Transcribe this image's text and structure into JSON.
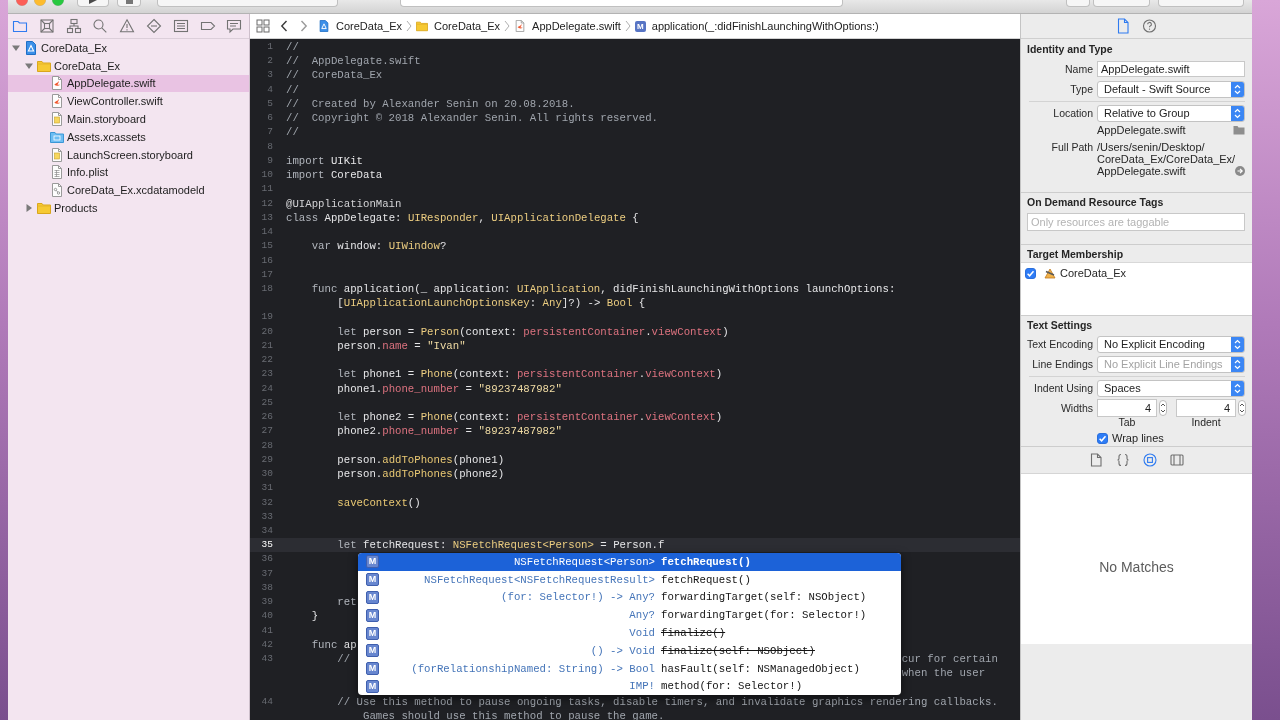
{
  "navigator": {
    "tabs": [
      {
        "selected": true
      },
      {
        "selected": false
      },
      {
        "selected": false
      },
      {
        "selected": false
      },
      {
        "selected": false
      },
      {
        "selected": false
      },
      {
        "selected": false
      },
      {
        "selected": false
      },
      {
        "selected": false
      }
    ],
    "tree": [
      {
        "label": "CoreData_Ex",
        "kind": "project",
        "expanded": true,
        "selected": false,
        "children": [
          {
            "label": "CoreData_Ex",
            "kind": "folder",
            "expanded": true,
            "selected": false,
            "children": [
              {
                "label": "AppDelegate.swift",
                "kind": "swift",
                "selected": true
              },
              {
                "label": "ViewController.swift",
                "kind": "swift",
                "selected": false
              },
              {
                "label": "Main.storyboard",
                "kind": "storyboard",
                "selected": false
              },
              {
                "label": "Assets.xcassets",
                "kind": "assets",
                "selected": false
              },
              {
                "label": "LaunchScreen.storyboard",
                "kind": "storyboard",
                "selected": false
              },
              {
                "label": "Info.plist",
                "kind": "plist",
                "selected": false
              },
              {
                "label": "CoreData_Ex.xcdatamodeld",
                "kind": "datamodel",
                "selected": false
              }
            ]
          },
          {
            "label": "Products",
            "kind": "folder",
            "expanded": false,
            "selected": false
          }
        ]
      }
    ]
  },
  "editor": {
    "jump_bar": {
      "crumbs": [
        {
          "kind": "project",
          "label": "CoreData_Ex"
        },
        {
          "kind": "folder",
          "label": "CoreData_Ex"
        },
        {
          "kind": "swift",
          "label": "AppDelegate.swift"
        },
        {
          "kind": "method",
          "symbol": "M",
          "label": "application(_:didFinishLaunchingWithOptions:)"
        }
      ]
    },
    "lines": [
      {
        "number": "1",
        "current": false,
        "tokens": [
          {
            "kind": "comment",
            "text": "//"
          }
        ]
      },
      {
        "number": "2",
        "current": false,
        "tokens": [
          {
            "kind": "comment",
            "text": "//  AppDelegate.swift"
          }
        ]
      },
      {
        "number": "3",
        "current": false,
        "tokens": [
          {
            "kind": "comment",
            "text": "//  CoreData_Ex"
          }
        ]
      },
      {
        "number": "4",
        "current": false,
        "tokens": [
          {
            "kind": "comment",
            "text": "//"
          }
        ]
      },
      {
        "number": "5",
        "current": false,
        "tokens": [
          {
            "kind": "comment",
            "text": "//  Created by Alexander Senin on 20.08.2018."
          }
        ]
      },
      {
        "number": "6",
        "current": false,
        "tokens": [
          {
            "kind": "comment",
            "text": "//  Copyright © 2018 Alexander Senin. All rights reserved."
          }
        ]
      },
      {
        "number": "7",
        "current": false,
        "tokens": [
          {
            "kind": "comment",
            "text": "//"
          }
        ]
      },
      {
        "number": "8",
        "current": false
      },
      {
        "number": "9",
        "current": false,
        "tokens": [
          {
            "kind": "keyword",
            "text": "import"
          },
          {
            "kind": "plain",
            "text": " UIKit"
          }
        ]
      },
      {
        "number": "10",
        "current": false,
        "tokens": [
          {
            "kind": "keyword",
            "text": "import"
          },
          {
            "kind": "plain",
            "text": " CoreData"
          }
        ]
      },
      {
        "number": "11",
        "current": false
      },
      {
        "number": "12",
        "current": false,
        "tokens": [
          {
            "kind": "attribute",
            "text": "@UIApplicationMain"
          }
        ]
      },
      {
        "number": "13",
        "current": false,
        "tokens": [
          {
            "kind": "keyword",
            "text": "class"
          },
          {
            "kind": "plain",
            "text": " AppDelegate: "
          },
          {
            "kind": "type",
            "text": "UIResponder"
          },
          {
            "kind": "plain",
            "text": ", "
          },
          {
            "kind": "type",
            "text": "UIApplicationDelegate"
          },
          {
            "kind": "plain",
            "text": " {"
          }
        ]
      },
      {
        "number": "14",
        "current": false
      },
      {
        "number": "15",
        "current": false,
        "tokens": [
          {
            "kind": "keyword",
            "text": "    var"
          },
          {
            "kind": "plain",
            "text": " window: "
          },
          {
            "kind": "type",
            "text": "UIWindow"
          },
          {
            "kind": "plain",
            "text": "?"
          }
        ]
      },
      {
        "number": "16",
        "current": false
      },
      {
        "number": "17",
        "current": false
      },
      {
        "number": "18",
        "current": false,
        "rows": [
          {
            "kind": "code",
            "tokens": [
              {
                "kind": "keyword",
                "text": "    func"
              },
              {
                "kind": "plain",
                "text": " application(_ application: "
              },
              {
                "kind": "type",
                "text": "UIApplication"
              },
              {
                "kind": "plain",
                "text": ", didFinishLaunchingWithOptions launchOptions:"
              }
            ]
          },
          {
            "kind": "code",
            "tokens": [
              {
                "kind": "plain",
                "text": "        ["
              },
              {
                "kind": "type",
                "text": "UIApplicationLaunchOptionsKey"
              },
              {
                "kind": "plain",
                "text": ": "
              },
              {
                "kind": "type",
                "text": "Any"
              },
              {
                "kind": "plain",
                "text": "]?) -> "
              },
              {
                "kind": "type",
                "text": "Bool"
              },
              {
                "kind": "plain",
                "text": " {"
              }
            ]
          }
        ]
      },
      {
        "number": "19",
        "current": false
      },
      {
        "number": "20",
        "current": false,
        "tokens": [
          {
            "kind": "keyword",
            "text": "        let"
          },
          {
            "kind": "plain",
            "text": " person = "
          },
          {
            "kind": "type",
            "text": "Person"
          },
          {
            "kind": "plain",
            "text": "(context: "
          },
          {
            "kind": "property",
            "text": "persistentContainer"
          },
          {
            "kind": "plain",
            "text": "."
          },
          {
            "kind": "property",
            "text": "viewContext"
          },
          {
            "kind": "plain",
            "text": ")"
          }
        ]
      },
      {
        "number": "21",
        "current": false,
        "tokens": [
          {
            "kind": "plain",
            "text": "        person."
          },
          {
            "kind": "property",
            "text": "name"
          },
          {
            "kind": "plain",
            "text": " = "
          },
          {
            "kind": "string",
            "text": "\"Ivan\""
          }
        ]
      },
      {
        "number": "22",
        "current": false
      },
      {
        "number": "23",
        "current": false,
        "tokens": [
          {
            "kind": "keyword",
            "text": "        let"
          },
          {
            "kind": "plain",
            "text": " phone1 = "
          },
          {
            "kind": "type",
            "text": "Phone"
          },
          {
            "kind": "plain",
            "text": "(context: "
          },
          {
            "kind": "property",
            "text": "persistentContainer"
          },
          {
            "kind": "plain",
            "text": "."
          },
          {
            "kind": "property",
            "text": "viewContext"
          },
          {
            "kind": "plain",
            "text": ")"
          }
        ]
      },
      {
        "number": "24",
        "current": false,
        "tokens": [
          {
            "kind": "plain",
            "text": "        phone1."
          },
          {
            "kind": "property",
            "text": "phone_number"
          },
          {
            "kind": "plain",
            "text": " = "
          },
          {
            "kind": "string",
            "text": "\"89237487982\""
          }
        ]
      },
      {
        "number": "25",
        "current": false
      },
      {
        "number": "26",
        "current": false,
        "tokens": [
          {
            "kind": "keyword",
            "text": "        let"
          },
          {
            "kind": "plain",
            "text": " phone2 = "
          },
          {
            "kind": "type",
            "text": "Phone"
          },
          {
            "kind": "plain",
            "text": "(context: "
          },
          {
            "kind": "property",
            "text": "persistentContainer"
          },
          {
            "kind": "plain",
            "text": "."
          },
          {
            "kind": "property",
            "text": "viewContext"
          },
          {
            "kind": "plain",
            "text": ")"
          }
        ]
      },
      {
        "number": "27",
        "current": false,
        "tokens": [
          {
            "kind": "plain",
            "text": "        phone2."
          },
          {
            "kind": "property",
            "text": "phone_number"
          },
          {
            "kind": "plain",
            "text": " = "
          },
          {
            "kind": "string",
            "text": "\"89237487982\""
          }
        ]
      },
      {
        "number": "28",
        "current": false
      },
      {
        "number": "29",
        "current": false,
        "tokens": [
          {
            "kind": "plain",
            "text": "        person."
          },
          {
            "kind": "method",
            "text": "addToPhones"
          },
          {
            "kind": "plain",
            "text": "(phone1)"
          }
        ]
      },
      {
        "number": "30",
        "current": false,
        "tokens": [
          {
            "kind": "plain",
            "text": "        person."
          },
          {
            "kind": "method",
            "text": "addToPhones"
          },
          {
            "kind": "plain",
            "text": "(phone2)"
          }
        ]
      },
      {
        "number": "31",
        "current": false
      },
      {
        "number": "32",
        "current": false,
        "tokens": [
          {
            "kind": "method",
            "text": "        saveContext"
          },
          {
            "kind": "plain",
            "text": "()"
          }
        ]
      },
      {
        "number": "33",
        "current": false
      },
      {
        "number": "34",
        "current": false
      },
      {
        "number": "35",
        "current": true,
        "tokens": [
          {
            "kind": "keyword",
            "text": "        let"
          },
          {
            "kind": "plain",
            "text": " fetchRequest: "
          },
          {
            "kind": "type",
            "text": "NSFetchRequest<Person>"
          },
          {
            "kind": "plain",
            "text": " = Person.f"
          }
        ]
      },
      {
        "number": "36",
        "current": false
      },
      {
        "number": "37",
        "current": false
      },
      {
        "number": "38",
        "current": false
      },
      {
        "number": "39",
        "current": false,
        "tokens": [
          {
            "kind": "keyword",
            "text": "        ret"
          }
        ]
      },
      {
        "number": "40",
        "current": false,
        "tokens": [
          {
            "kind": "plain",
            "text": "    }"
          }
        ]
      },
      {
        "number": "41",
        "current": false
      },
      {
        "number": "42",
        "current": false,
        "tokens": [
          {
            "kind": "keyword",
            "text": "    func"
          },
          {
            "kind": "plain",
            "text": " ap"
          }
        ]
      },
      {
        "number": "43",
        "current": false,
        "rows": [
          {
            "kind": "code",
            "tokens": [
              {
                "kind": "comment",
                "text": "        //"
              }
            ],
            "after_popup": [
              {
                "kind": "comment",
                "text": "cur for certain"
              }
            ]
          },
          {
            "kind": "code",
            "after_popup": [
              {
                "kind": "comment",
                "text": "when the user"
              }
            ]
          },
          {
            "kind": "covered"
          }
        ]
      },
      {
        "number": "44",
        "current": false,
        "rows": [
          {
            "kind": "code",
            "tokens": [
              {
                "kind": "comment",
                "text": "        // Use this method to pause ongoing tasks, disable timers, and invalidate graphics rendering callbacks."
              }
            ]
          },
          {
            "kind": "code",
            "tokens": [
              {
                "kind": "comment",
                "text": "            Games should use this method to pause the game."
              }
            ]
          }
        ]
      }
    ],
    "completion": {
      "items": [
        {
          "symbol": "M",
          "type": "NSFetchRequest<Person>",
          "name": "fetchRequest()",
          "selected": true,
          "deprecated": false
        },
        {
          "symbol": "M",
          "type": "NSFetchRequest<NSFetchRequestResult>",
          "name": "fetchRequest()",
          "selected": false,
          "deprecated": false
        },
        {
          "symbol": "M",
          "type": "(for: Selector!) -> Any?",
          "name": "forwardingTarget(self: NSObject)",
          "selected": false,
          "deprecated": false
        },
        {
          "symbol": "M",
          "type": "Any?",
          "name": "forwardingTarget(for: Selector!)",
          "selected": false,
          "deprecated": false
        },
        {
          "symbol": "M",
          "type": "Void",
          "name": "finalize()",
          "selected": false,
          "deprecated": true
        },
        {
          "symbol": "M",
          "type": "() -> Void",
          "name": "finalize(self: NSObject)",
          "selected": false,
          "deprecated": true
        },
        {
          "symbol": "M",
          "type": "(forRelationshipNamed: String) -> Bool",
          "name": "hasFault(self: NSManagedObject)",
          "selected": false,
          "deprecated": false
        },
        {
          "symbol": "M",
          "type": "IMP!",
          "name": "method(for: Selector!)",
          "selected": false,
          "deprecated": false
        }
      ]
    }
  },
  "inspector": {
    "tabs": [
      {
        "selected": true
      },
      {
        "selected": false
      }
    ],
    "identity": {
      "title": "Identity and Type",
      "name": {
        "label": "Name",
        "value": "AppDelegate.swift"
      },
      "type": {
        "label": "Type",
        "value": "Default - Swift Source"
      },
      "location": {
        "label": "Location",
        "value": "Relative to Group",
        "file": "AppDelegate.swift"
      },
      "full_path": {
        "label": "Full Path",
        "lines": [
          "/Users/senin/Desktop/",
          "CoreData_Ex/CoreData_Ex/",
          "AppDelegate.swift"
        ]
      }
    },
    "resource_tags": {
      "title": "On Demand Resource Tags",
      "placeholder": "Only resources are taggable"
    },
    "target_membership": {
      "title": "Target Membership",
      "targets": [
        {
          "label": "CoreData_Ex",
          "checked": true
        }
      ]
    },
    "text_settings": {
      "title": "Text Settings",
      "encoding": {
        "label": "Text Encoding",
        "value": "No Explicit Encoding",
        "disabled": false
      },
      "line_endings": {
        "label": "Line Endings",
        "value": "No Explicit Line Endings",
        "disabled": true
      },
      "indent_using": {
        "label": "Indent Using",
        "value": "Spaces",
        "disabled": false
      },
      "widths": {
        "label": "Widths",
        "tab": {
          "value": "4",
          "caption": "Tab"
        },
        "indent": {
          "value": "4",
          "caption": "Indent"
        }
      },
      "wrap_lines": {
        "label": "Wrap lines",
        "checked": true
      }
    },
    "library": {
      "tabs": [
        {
          "selected": false
        },
        {
          "selected": false
        },
        {
          "selected": true
        },
        {
          "selected": false
        }
      ],
      "empty_text": "No Matches"
    }
  }
}
